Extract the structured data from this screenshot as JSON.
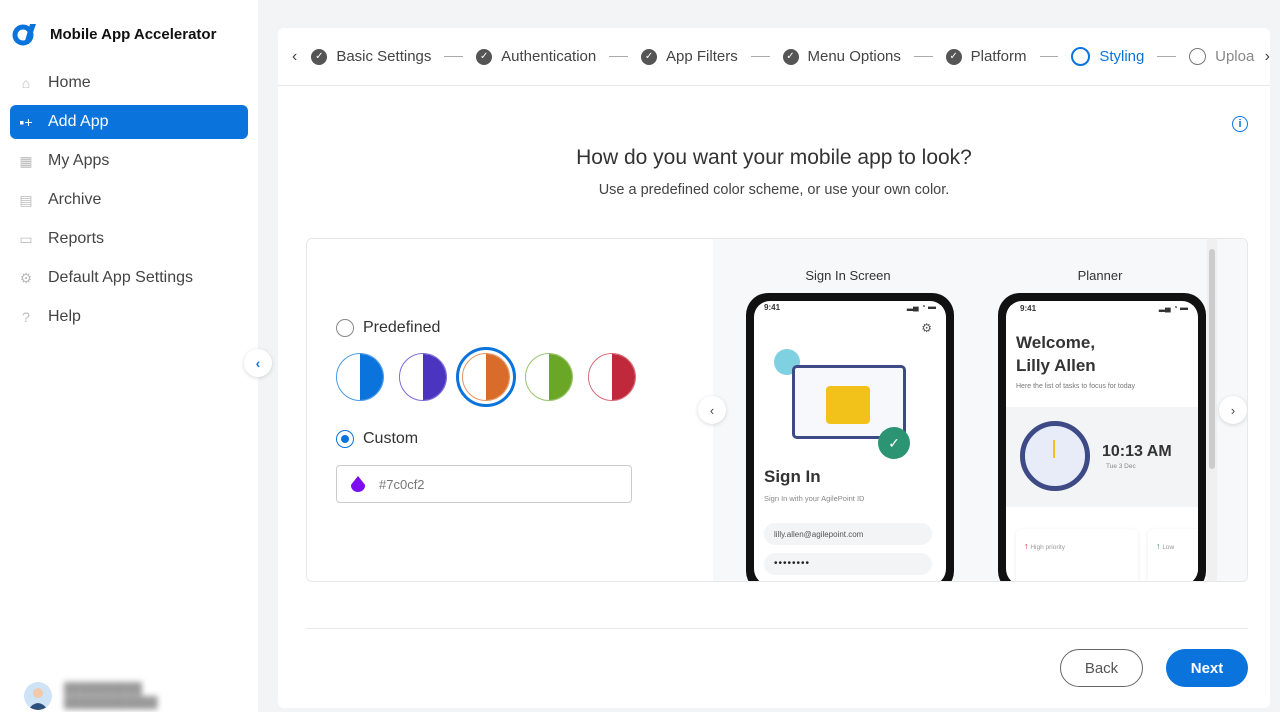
{
  "app": {
    "title": "Mobile App Accelerator"
  },
  "sidebar": {
    "items": [
      {
        "label": "Home",
        "icon": "home-icon"
      },
      {
        "label": "Add App",
        "icon": "add-app-icon",
        "active": true
      },
      {
        "label": "My Apps",
        "icon": "apps-grid-icon"
      },
      {
        "label": "Archive",
        "icon": "archive-icon"
      },
      {
        "label": "Reports",
        "icon": "reports-icon"
      },
      {
        "label": "Default App Settings",
        "icon": "gear-icon"
      },
      {
        "label": "Help",
        "icon": "help-icon"
      }
    ]
  },
  "stepper": {
    "steps": [
      {
        "label": "Basic Settings",
        "state": "done"
      },
      {
        "label": "Authentication",
        "state": "done"
      },
      {
        "label": "App Filters",
        "state": "done"
      },
      {
        "label": "Menu Options",
        "state": "done"
      },
      {
        "label": "Platform",
        "state": "done"
      },
      {
        "label": "Styling",
        "state": "current"
      },
      {
        "label": "Uploa",
        "state": "pending"
      }
    ]
  },
  "main": {
    "title": "How do you want your mobile app to look?",
    "subtitle": "Use a predefined color scheme, or use your own color.",
    "predefined_label": "Predefined",
    "custom_label": "Custom",
    "custom_value": "#7c0cf2",
    "selected_option": "Custom",
    "swatches": [
      {
        "color": "#0a74dc",
        "border": "#4a9be6"
      },
      {
        "color": "#4b34bf",
        "border": "#7e6bd6"
      },
      {
        "color": "#d96c2a",
        "border": "#e6955f",
        "selected": true
      },
      {
        "color": "#6aa726",
        "border": "#98c56b"
      },
      {
        "color": "#c0283b",
        "border": "#d76b78"
      }
    ]
  },
  "preview": {
    "signin": {
      "label": "Sign In Screen",
      "time": "9:41",
      "heading": "Sign In",
      "subtext": "Sign In with your AgilePoint ID",
      "email": "lilly.allen@agilepoint.com",
      "password": "••••••••"
    },
    "planner": {
      "label": "Planner",
      "time": "9:41",
      "welcome": "Welcome,",
      "name": "Lilly Allen",
      "subtext": "Here the list of tasks to focus for today",
      "clock_time": "10:13 AM",
      "date": "Tue 3 Dec",
      "high": "High priority",
      "low": "Low"
    }
  },
  "footer": {
    "back": "Back",
    "next": "Next"
  }
}
